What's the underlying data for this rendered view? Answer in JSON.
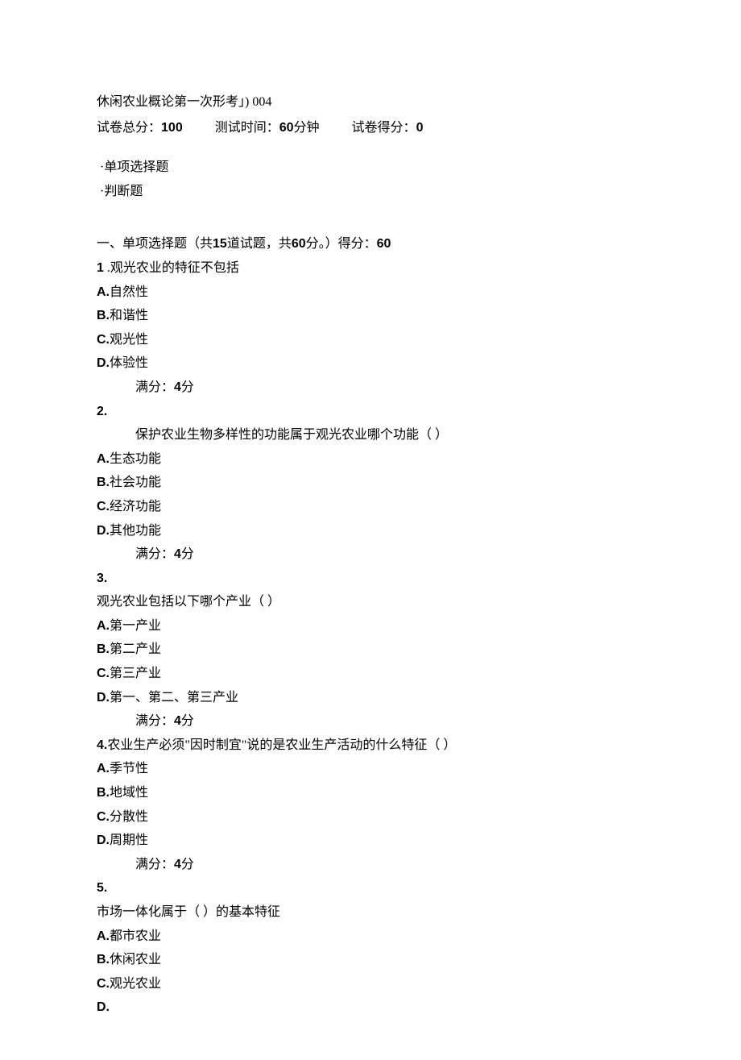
{
  "header": {
    "title": "休闲农业概论第一次形考」) 004",
    "total_label": "试卷总分：",
    "total_value": "100",
    "time_label": "测试时间：",
    "time_value": "60",
    "time_unit": "分钟",
    "score_label": "试卷得分：",
    "score_value": "0"
  },
  "nav": {
    "item1": "单项选择题",
    "item2": "判断题"
  },
  "section1": {
    "heading_prefix": "一、单项选择题（共",
    "heading_count": "15",
    "heading_mid": "道试题，共",
    "heading_pts": "60",
    "heading_suffix": "分。）得分：",
    "heading_score": "60",
    "full_label_prefix": "满分：",
    "full_label_value": "4",
    "full_label_suffix": "分",
    "q1": {
      "num": "1",
      "stem": " .观光农业的特征不包括",
      "A": "自然性",
      "B": "和谐性",
      "C": "观光性",
      "D": "体验性"
    },
    "q2": {
      "num": "2.",
      "stem": "保护农业生物多样性的功能属于观光农业哪个功能（                        ）",
      "A": "生态功能",
      "B": "社会功能",
      "C": "经济功能",
      "D": "其他功能"
    },
    "q3": {
      "num": "3.",
      "stem": "观光农业包括以下哪个产业（                              ）",
      "A": "第一产业",
      "B": "第二产业",
      "C": "第三产业",
      "D": "第一、第二、第三产业"
    },
    "q4": {
      "num": "4.",
      "stem": "农业生产必须\"因时制宜\"说的是农业生产活动的什么特征（                    ）",
      "A": "季节性",
      "B": "地域性",
      "C": "分散性",
      "D": "周期性"
    },
    "q5": {
      "num": "5.",
      "stem": "市场一体化属于（                  ）的基本特征",
      "A": "都市农业",
      "B": "休闲农业",
      "C": "观光农业",
      "D": ""
    }
  },
  "labels": {
    "A": "A.",
    "B": "B.",
    "C": "C.",
    "D": "D."
  }
}
